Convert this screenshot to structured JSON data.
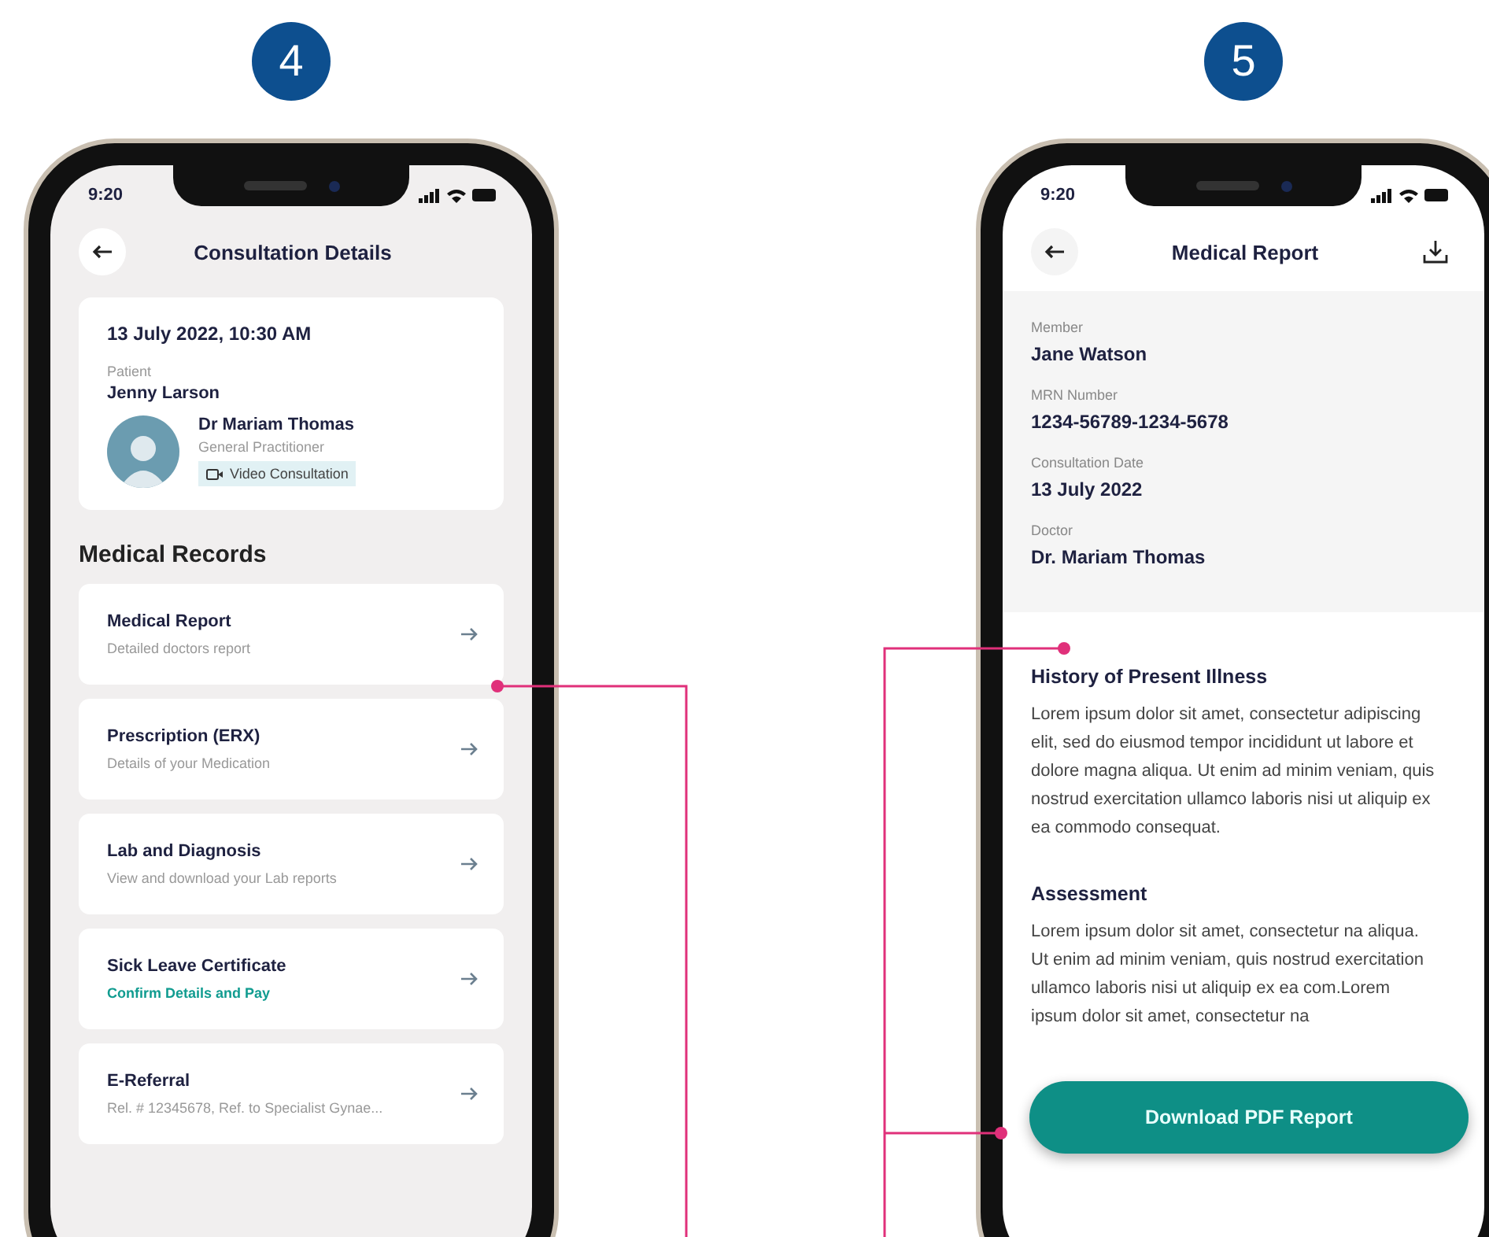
{
  "left": {
    "step": "4",
    "status_time": "9:20",
    "title": "Consultation Details",
    "consultation": {
      "datetime": "13 July 2022, 10:30 AM",
      "patient_label": "Patient",
      "patient_name": "Jenny Larson",
      "doctor_name": "Dr Mariam Thomas",
      "doctor_role": "General Practitioner",
      "tag": "Video Consultation"
    },
    "section_title": "Medical Records",
    "records": [
      {
        "title": "Medical Report",
        "subtitle": "Detailed doctors report",
        "kind": "plain"
      },
      {
        "title": "Prescription (ERX)",
        "subtitle": "Details of your Medication",
        "kind": "plain"
      },
      {
        "title": "Lab and Diagnosis",
        "subtitle": "View and download your Lab reports",
        "kind": "plain"
      },
      {
        "title": "Sick Leave Certificate",
        "subtitle": "Confirm Details and Pay",
        "kind": "action"
      },
      {
        "title": "E-Referral",
        "subtitle": "Rel. # 12345678, Ref. to Specialist Gynae...",
        "kind": "plain"
      }
    ]
  },
  "right": {
    "step": "5",
    "status_time": "9:20",
    "title": "Medical Report",
    "fields": [
      {
        "label": "Member",
        "value": "Jane Watson"
      },
      {
        "label": "MRN Number",
        "value": "1234-56789-1234-5678"
      },
      {
        "label": "Consultation Date",
        "value": "13 July 2022"
      },
      {
        "label": "Doctor",
        "value": "Dr. Mariam Thomas"
      }
    ],
    "sections": [
      {
        "title": "History of Present Illness",
        "body": "Lorem ipsum dolor sit amet, consectetur adipiscing elit, sed do eiusmod tempor incididunt ut labore et dolore magna aliqua. Ut enim ad minim veniam, quis nostrud exercitation ullamco laboris nisi ut aliquip ex ea commodo consequat."
      },
      {
        "title": "Assessment",
        "body": "Lorem ipsum dolor sit amet, consectetur na aliqua. Ut enim ad minim veniam, quis nostrud exercitation ullamco laboris nisi ut aliquip ex ea com.Lorem ipsum dolor sit amet, consectetur na"
      }
    ],
    "button": "Download PDF Report"
  }
}
